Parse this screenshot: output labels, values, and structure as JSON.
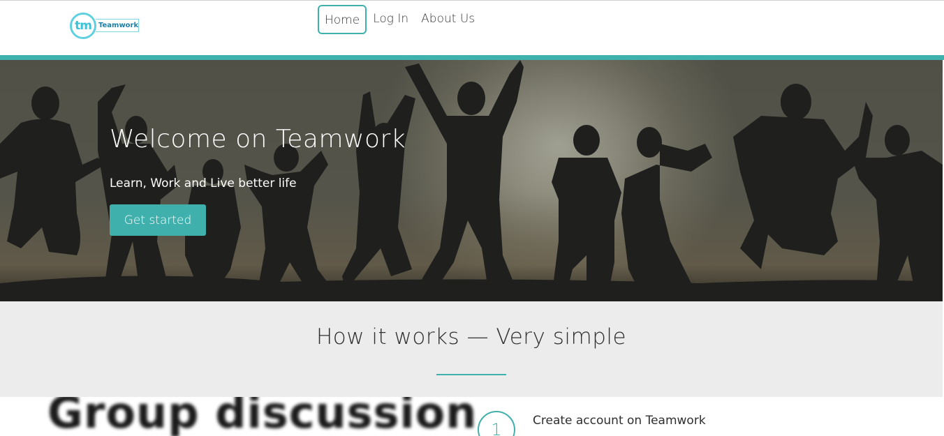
{
  "header": {
    "logo_mark": "tm",
    "logo_word": "Teamwork",
    "nav": [
      "Home",
      "Log In",
      "About Us"
    ],
    "active_nav": "Home"
  },
  "hero": {
    "title": "Welcome on Teamwork",
    "subtitle": "Learn, Work and Live better life",
    "cta_label": "Get started"
  },
  "how_it_works": {
    "title": "How it works — Very simple"
  },
  "lower": {
    "image_text": "Group discussion",
    "steps": [
      {
        "number": "1",
        "text": "Create account on Teamwork"
      }
    ]
  },
  "colors": {
    "accent": "#3fb0ac",
    "logo": "#5fd0e0",
    "section_bg": "#ececec"
  }
}
